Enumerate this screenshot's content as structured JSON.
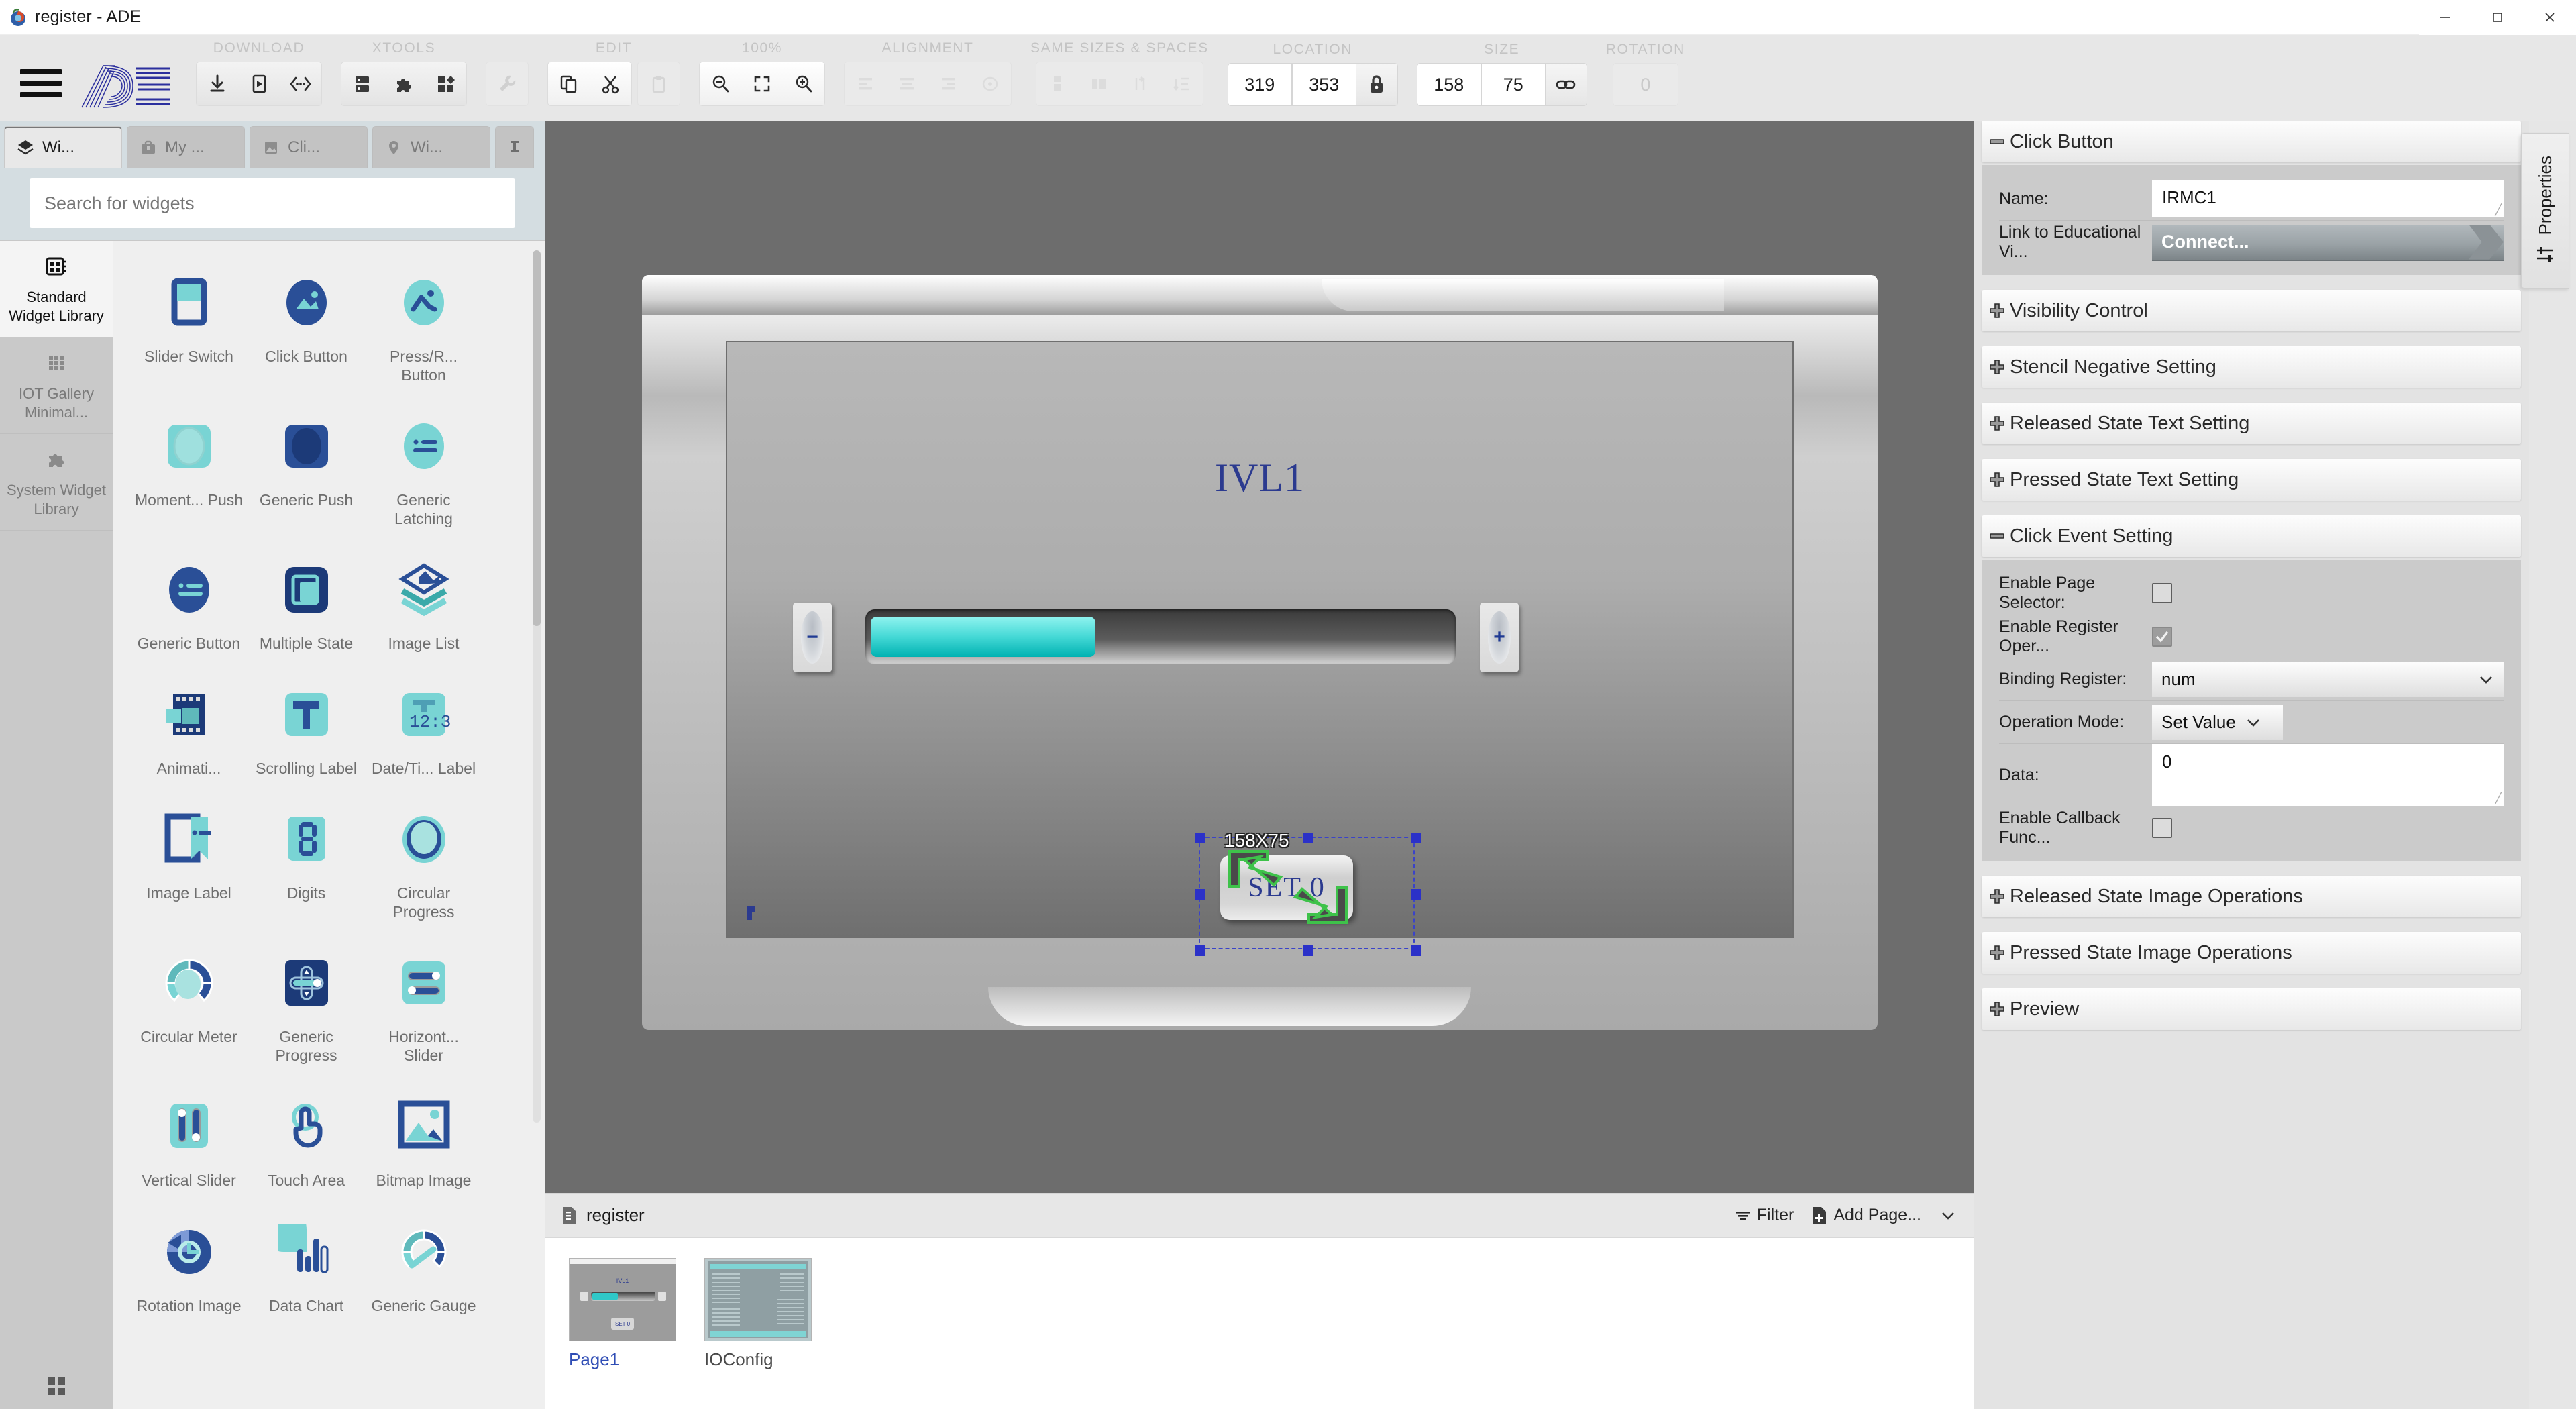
{
  "window": {
    "title": "register - ADE",
    "app_icon": "ade-logo-icon",
    "controls": {
      "minimize": "–",
      "maximize": "❐",
      "close": "✕"
    }
  },
  "ribbon": {
    "menu_icon": "hamburger-icon",
    "brand": "ADE",
    "groups": [
      {
        "label": "DOWNLOAD",
        "buttons": [
          {
            "name": "download-button",
            "icon": "download-icon"
          },
          {
            "name": "simulate-button",
            "icon": "device-play-icon"
          },
          {
            "name": "code-button",
            "icon": "code-brackets-icon"
          }
        ]
      },
      {
        "label": "XTOOLS",
        "buttons": [
          {
            "name": "server-tool-button",
            "icon": "server-icon"
          },
          {
            "name": "plugin-tool-button",
            "icon": "puzzle-icon"
          },
          {
            "name": "components-tool-button",
            "icon": "blocks-icon"
          }
        ]
      },
      {
        "label": "",
        "buttons": [
          {
            "name": "wrench-button",
            "icon": "wrench-icon"
          }
        ]
      },
      {
        "label": "EDIT",
        "buttons": [
          {
            "name": "copy-button",
            "icon": "copy-icon"
          },
          {
            "name": "cut-button",
            "icon": "scissors-icon"
          },
          {
            "name": "paste-button",
            "icon": "clipboard-icon"
          }
        ]
      },
      {
        "label": "100%",
        "buttons": [
          {
            "name": "zoom-out-button",
            "icon": "magnifier-minus-icon"
          },
          {
            "name": "fit-screen-button",
            "icon": "fit-frame-icon"
          },
          {
            "name": "zoom-in-button",
            "icon": "magnifier-plus-icon"
          }
        ]
      },
      {
        "label": "ALIGNMENT",
        "buttons": [
          {
            "name": "align-left-button",
            "icon": "align-left-icon"
          },
          {
            "name": "align-center-button",
            "icon": "align-center-icon"
          },
          {
            "name": "align-right-button",
            "icon": "align-right-icon"
          },
          {
            "name": "align-distribute-button",
            "icon": "align-target-icon"
          }
        ]
      },
      {
        "label": "SAME SIZES & SPACES",
        "buttons": [
          {
            "name": "same-height-button",
            "icon": "same-height-icon"
          },
          {
            "name": "same-width-button",
            "icon": "same-width-icon"
          },
          {
            "name": "space-horizontal-button",
            "icon": "space-horizontal-icon"
          },
          {
            "name": "space-vertical-button",
            "icon": "space-vertical-icon"
          }
        ]
      }
    ],
    "location": {
      "label": "LOCATION",
      "x": "319",
      "y": "353",
      "lock_icon": "lock-icon"
    },
    "size": {
      "label": "SIZE",
      "w": "158",
      "h": "75",
      "link_icon": "link-icon"
    },
    "rotation": {
      "label": "ROTATION",
      "value": "0"
    }
  },
  "left_panel": {
    "tabs": [
      {
        "label": "Wi...",
        "icon": "layers-icon",
        "active": true
      },
      {
        "label": "My ...",
        "icon": "briefcase-icon",
        "active": false
      },
      {
        "label": "Cli...",
        "icon": "image-icon",
        "active": false
      },
      {
        "label": "Wi...",
        "icon": "location-pin-icon",
        "active": false
      }
    ],
    "pin_icon": "pin-icon",
    "search": {
      "placeholder": "Search for widgets",
      "value": ""
    },
    "libraries": [
      {
        "label": "Standard Widget Library",
        "icon": "widget-book-icon",
        "active": true
      },
      {
        "label": "IOT Gallery Minimal...",
        "icon": "grid-dots-icon",
        "active": false
      },
      {
        "label": "System Widget Library",
        "icon": "puzzle-icon",
        "active": false
      }
    ],
    "widgets": [
      {
        "label": "Slider Switch",
        "icon": "slider-switch-icon"
      },
      {
        "label": "Click Button",
        "icon": "click-button-icon"
      },
      {
        "label": "Press/R... Button",
        "icon": "press-release-button-icon"
      },
      {
        "label": "Moment... Push",
        "icon": "momentary-push-icon"
      },
      {
        "label": "Generic Push",
        "icon": "generic-push-icon"
      },
      {
        "label": "Generic Latching",
        "icon": "generic-latching-icon"
      },
      {
        "label": "Generic Button",
        "icon": "generic-button-icon"
      },
      {
        "label": "Multiple State",
        "icon": "multiple-state-icon"
      },
      {
        "label": "Image List",
        "icon": "image-list-icon"
      },
      {
        "label": "Animati...",
        "icon": "animation-icon"
      },
      {
        "label": "Scrolling Label",
        "icon": "scrolling-label-icon"
      },
      {
        "label": "Date/Ti... Label",
        "icon": "datetime-label-icon"
      },
      {
        "label": "Image Label",
        "icon": "image-label-icon"
      },
      {
        "label": "Digits",
        "icon": "digits-icon"
      },
      {
        "label": "Circular Progress",
        "icon": "circular-progress-icon"
      },
      {
        "label": "Circular Meter",
        "icon": "circular-meter-icon"
      },
      {
        "label": "Generic Progress",
        "icon": "generic-progress-icon"
      },
      {
        "label": "Horizont... Slider",
        "icon": "horizontal-slider-icon"
      },
      {
        "label": "Vertical Slider",
        "icon": "vertical-slider-icon"
      },
      {
        "label": "Touch Area",
        "icon": "touch-area-icon"
      },
      {
        "label": "Bitmap Image",
        "icon": "bitmap-image-icon"
      },
      {
        "label": "Rotation Image",
        "icon": "rotation-image-icon"
      },
      {
        "label": "Data Chart",
        "icon": "data-chart-icon"
      },
      {
        "label": "Generic Gauge",
        "icon": "generic-gauge-icon"
      }
    ],
    "grid_toggle_icon": "grid-icon"
  },
  "canvas": {
    "screen_title": "IVL1",
    "minus_button": "−",
    "plus_button": "+",
    "selected_widget": {
      "text": "SET 0",
      "size_badge": "158X75",
      "resize_overlay_icon": "resize-arrows-icon"
    }
  },
  "pages_panel": {
    "doc_icon": "document-icon",
    "title": "register",
    "filter_label": "Filter",
    "filter_icon": "filter-icon",
    "add_page_label": "Add Page...",
    "add_page_icon": "add-page-icon",
    "more_icon": "chevron-down-icon",
    "pages": [
      {
        "name": "Page1",
        "selected": true
      },
      {
        "name": "IOConfig",
        "selected": false
      }
    ]
  },
  "properties": {
    "tab_label": "Properties",
    "tab_icon": "sliders-icon",
    "sections": [
      {
        "title": "Click Button",
        "expanded": true,
        "rows": [
          {
            "kind": "text",
            "label": "Name:",
            "value": "IRMC1"
          },
          {
            "kind": "button",
            "label": "Link to Educational Vi...",
            "value": "Connect..."
          }
        ]
      },
      {
        "title": "Visibility Control",
        "expanded": false,
        "rows": []
      },
      {
        "title": "Stencil Negative Setting",
        "expanded": false,
        "rows": []
      },
      {
        "title": "Released State Text Setting",
        "expanded": false,
        "rows": []
      },
      {
        "title": "Pressed State Text Setting",
        "expanded": false,
        "rows": []
      },
      {
        "title": "Click Event Setting",
        "expanded": true,
        "rows": [
          {
            "kind": "checkbox",
            "label": "Enable Page Selector:",
            "checked": false
          },
          {
            "kind": "checkbox",
            "label": "Enable Register Oper...",
            "checked": true
          },
          {
            "kind": "select",
            "label": "Binding Register:",
            "value": "num",
            "wide": true
          },
          {
            "kind": "select",
            "label": "Operation Mode:",
            "value": "Set Value",
            "wide": false
          },
          {
            "kind": "textarea",
            "label": "Data:",
            "value": "0"
          },
          {
            "kind": "checkbox",
            "label": "Enable Callback Func...",
            "checked": false
          }
        ]
      },
      {
        "title": "Released State Image Operations",
        "expanded": false,
        "rows": []
      },
      {
        "title": "Pressed State Image Operations",
        "expanded": false,
        "rows": []
      },
      {
        "title": "Preview",
        "expanded": false,
        "rows": []
      }
    ]
  },
  "colors": {
    "accent_blue": "#2b3a8f",
    "selection_blue": "#2b31c8",
    "teal": "#45d9d6",
    "panel_bg": "#e3e3e3",
    "canvas_bg": "#6d6d6d"
  }
}
